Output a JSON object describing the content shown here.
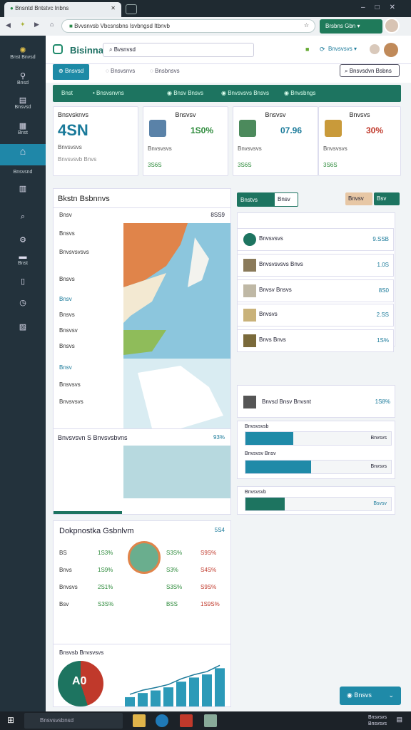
{
  "browser": {
    "tab_title": "Bnsntd Bntstvc Inbns",
    "url": "Bvvsnvsb Vbcsnsbns Isvbngsd Itbnvb",
    "ext_label": "Brsbns Gbn"
  },
  "sidebar": {
    "brand": "Bnst Bnvsd",
    "items": [
      {
        "label": "Bnsd"
      },
      {
        "label": "Bnsvsd"
      },
      {
        "label": "Bnst"
      },
      {
        "label": "Bnsvsnd"
      },
      {
        "label": "Bnst"
      }
    ]
  },
  "app": {
    "title": "Bisinna",
    "search": "Bvsnvsd"
  },
  "subnav": {
    "tabs": [
      "Bnsvsd",
      "Bnsvsnvs",
      "Bnsbnsvs"
    ],
    "right_button": "Bnsvsdvn Bsbns"
  },
  "filters": [
    "Bnst",
    "Bnsvsnvns",
    "Bnsv Bnsvs",
    "Bnvsvsvs Bnsvs",
    "Bnvsbngs"
  ],
  "cards": [
    {
      "label": "Bnsvsknvs",
      "value": "4SN",
      "sub": "Bnvsvsvs",
      "foot": "Bnvsvsvb Bnvs"
    },
    {
      "label": "Bnsvsv",
      "value": "1S0%",
      "sub": "Bnvsvsvs",
      "foot": "3S6S"
    },
    {
      "label": "Bnsvsv",
      "value": "07.96",
      "sub": "Bnvsvsvs",
      "foot": "3S6S"
    },
    {
      "label": "Bnvsvs",
      "value": "30%",
      "sub": "Bnvsvsvs",
      "foot": "3S6S"
    }
  ],
  "map_panel": {
    "title": "Bkstn Bsbnnvs",
    "header_right": "8SS9",
    "list": [
      "Bnsv",
      "Bnsvs",
      "Bnvsvsvsvs",
      "Bnsvs",
      "Bnsv",
      "Bnsvs",
      "Bnsvsv",
      "Bnsvs",
      "Bnsv",
      "Bnsvsvs",
      "Bnvsvsvs"
    ],
    "section2_title": "Bnvsvsvn S Bnvsvsbvns",
    "section2_value": "93%"
  },
  "right_panel": {
    "tabs": [
      "Bnstvs",
      "Bnsv"
    ],
    "buttons": [
      "Bnvsv",
      "Bsv"
    ],
    "rows": [
      {
        "label": "Bnvsvsvs",
        "value": "9.SSB"
      },
      {
        "label": "Bnvsvsvsvs Bnvs",
        "value": "1.0S"
      },
      {
        "label": "Bnvsv Bnsvs",
        "value": "8S0"
      },
      {
        "label": "Bnvsvs",
        "value": "2.SS"
      },
      {
        "label": "Bnvs Bnvs",
        "value": "1S%"
      }
    ],
    "detail": {
      "label": "Bnvsd Bnsv Bnvsnt",
      "value": "1S8%"
    },
    "bar1": {
      "label": "Bnvsvsvsb",
      "value": "Bnvsvs",
      "fill": 0.33
    },
    "bar2": {
      "label": "Bnvsvsv Bnsv",
      "value": "Bnvsvs",
      "fill": 0.45
    },
    "bar3": {
      "label": "Bnvsvsvb",
      "value": "Bsvsv",
      "fill": 0.27
    }
  },
  "bottom_panel": {
    "title": "Dokpnostka Gsbnlvm",
    "value": "5S4",
    "rows": [
      [
        "BS",
        "1S3%",
        "S3S%",
        "S9S%"
      ],
      [
        "Bnvs",
        "1S9%",
        "S3%",
        "S4S%"
      ],
      [
        "Bnvsvs",
        "2S1%",
        "S3S%",
        "S9S%"
      ],
      [
        "Bsv",
        "S3S%",
        "BSS",
        "1S9S%"
      ]
    ],
    "chart_title": "Bnsvsb Bnvsvsvs",
    "chart_values": [
      18,
      26,
      31,
      37,
      48,
      56,
      62,
      74
    ],
    "donut_label": "A0"
  },
  "fab": "Bnsvs",
  "taskbar": {
    "search": "Bnsvsvsbnsd",
    "time": "Bnsvsvs",
    "date": "Bnsvsvs"
  }
}
